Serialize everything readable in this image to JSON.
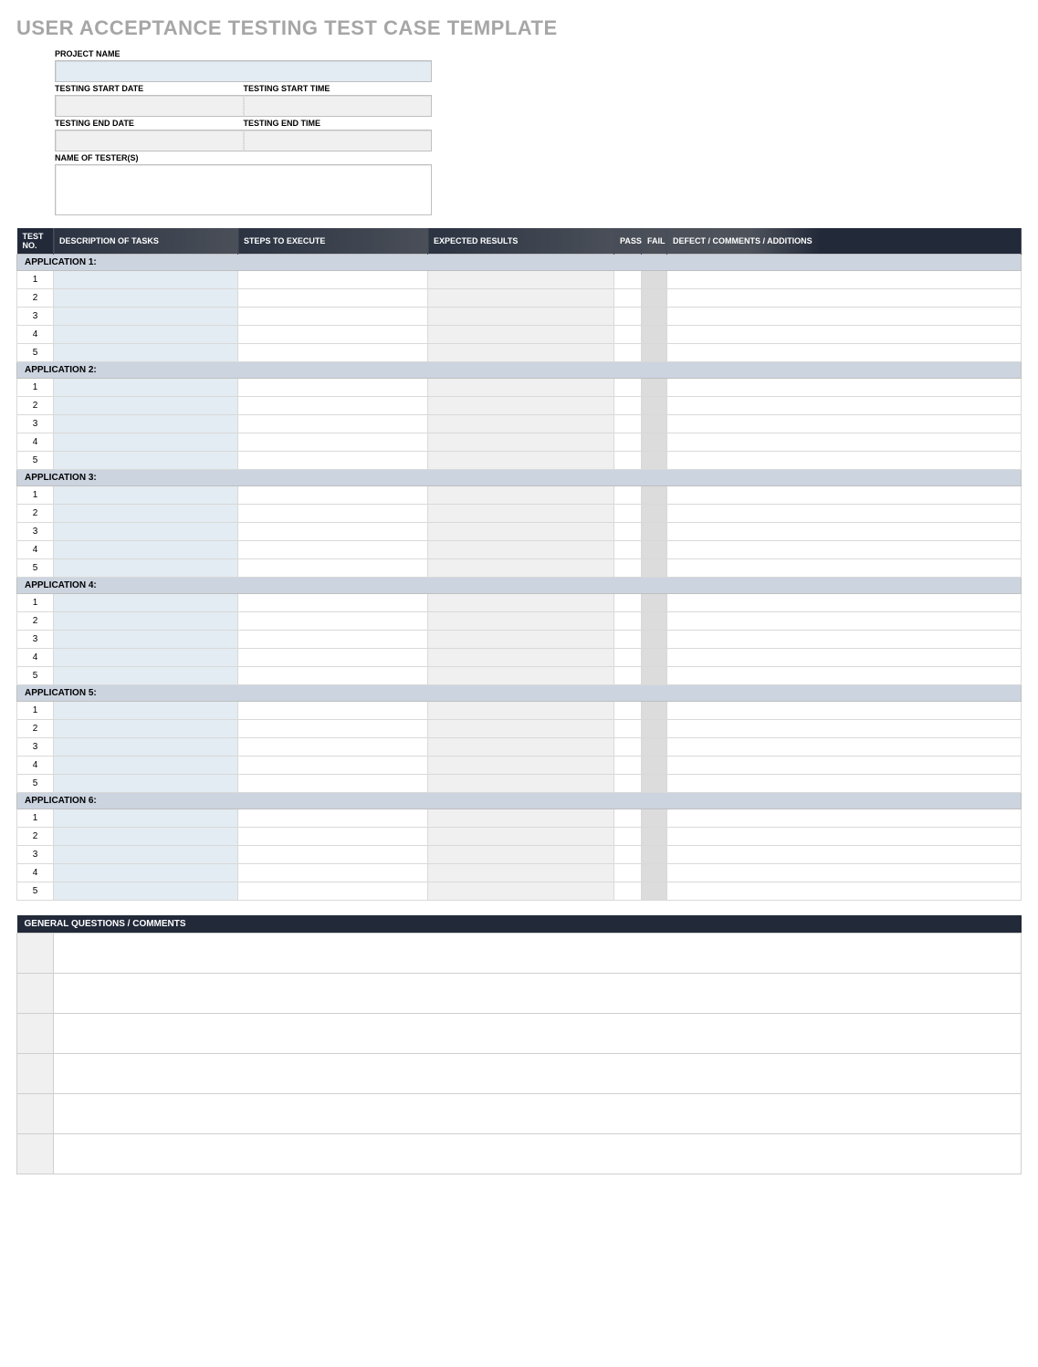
{
  "title": "USER ACCEPTANCE TESTING TEST CASE TEMPLATE",
  "meta": {
    "project_name_label": "PROJECT NAME",
    "start_date_label": "TESTING START DATE",
    "start_time_label": "TESTING START TIME",
    "end_date_label": "TESTING END DATE",
    "end_time_label": "TESTING END TIME",
    "testers_label": "NAME OF TESTER(S)"
  },
  "columns": {
    "test_no": "TEST NO.",
    "description": "DESCRIPTION OF TASKS",
    "steps": "STEPS TO EXECUTE",
    "expected": "EXPECTED RESULTS",
    "pass": "PASS",
    "fail": "FAIL",
    "defect": "DEFECT / COMMENTS / ADDITIONS"
  },
  "applications": [
    {
      "label": "APPLICATION 1:",
      "rows": [
        "1",
        "2",
        "3",
        "4",
        "5"
      ]
    },
    {
      "label": "APPLICATION 2:",
      "rows": [
        "1",
        "2",
        "3",
        "4",
        "5"
      ]
    },
    {
      "label": "APPLICATION 3:",
      "rows": [
        "1",
        "2",
        "3",
        "4",
        "5"
      ]
    },
    {
      "label": "APPLICATION 4:",
      "rows": [
        "1",
        "2",
        "3",
        "4",
        "5"
      ]
    },
    {
      "label": "APPLICATION 5:",
      "rows": [
        "1",
        "2",
        "3",
        "4",
        "5"
      ]
    },
    {
      "label": "APPLICATION 6:",
      "rows": [
        "1",
        "2",
        "3",
        "4",
        "5"
      ]
    }
  ],
  "comments_header": "GENERAL QUESTIONS / COMMENTS",
  "comments_rows": 6
}
